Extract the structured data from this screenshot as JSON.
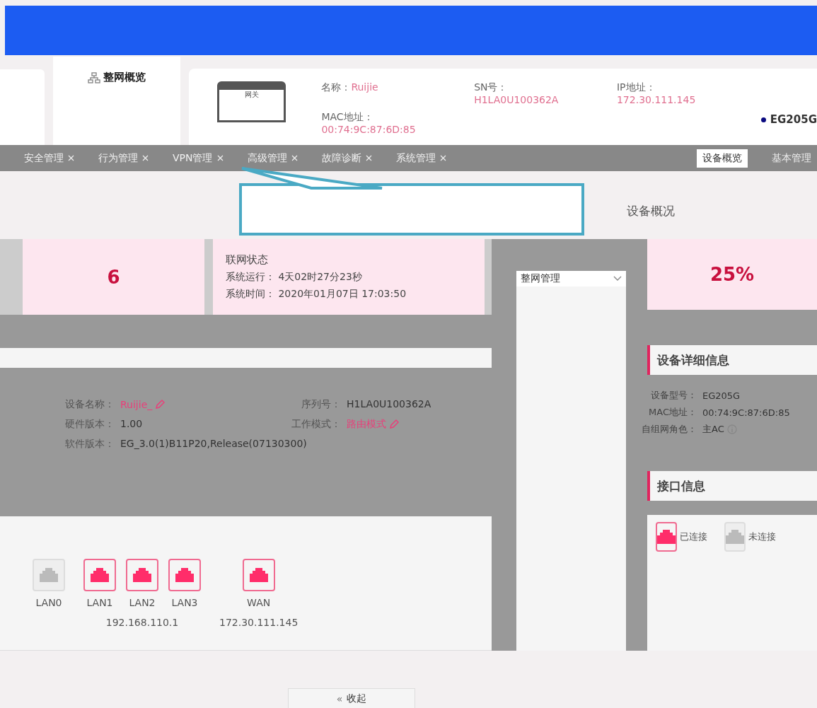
{
  "header_tab": {
    "label": "整网概览",
    "selected": true
  },
  "device": {
    "image_label": "网关",
    "fields": [
      {
        "label": "名称：",
        "value": "Ruijie"
      },
      {
        "label": "SN号：",
        "value": "H1LA0U100362A"
      },
      {
        "label": "IP地址：",
        "value": "172.30.111.145"
      },
      {
        "label": "MAC地址：",
        "value": "00:74:9C:87:6D:85"
      }
    ],
    "model": "EG205G"
  },
  "nav_tabs": [
    {
      "label": "安全管理",
      "selected": false
    },
    {
      "label": "行为管理",
      "selected": false
    },
    {
      "label": "VPN管理",
      "selected": false
    },
    {
      "label": "高级管理",
      "selected": false
    },
    {
      "label": "故障诊断",
      "selected": false
    },
    {
      "label": "系统管理",
      "selected": false
    }
  ],
  "right_tabs": [
    {
      "label": "设备概览",
      "selected": true
    },
    {
      "label": "基本管理",
      "selected": false
    }
  ],
  "section_title": "设备概况",
  "stats": [
    {
      "kind": "number",
      "value": "6"
    },
    {
      "kind": "status",
      "title": "联网状态",
      "lines": [
        {
          "label": "系统运行：",
          "value": "4天02时27分23秒"
        },
        {
          "label": "系统时间：",
          "value": "2020年01月07日 17:03:50"
        }
      ]
    }
  ],
  "device_info": [
    {
      "label": "设备名称：",
      "value": "Ruijie_",
      "editable": true
    },
    {
      "label": "序列号：",
      "value": "H1LA0U100362A",
      "editable": false
    },
    {
      "label": "硬件版本：",
      "value": "1.00",
      "editable": false
    },
    {
      "label": "工作模式：",
      "value": "路由模式",
      "editable": true
    },
    {
      "label": "软件版本：",
      "value": "EG_3.0(1)B11P20,Release(07130300)",
      "editable": false
    }
  ],
  "menu": {
    "label": "整网管理",
    "expanded": false
  },
  "usage": "25%",
  "details": {
    "title": "设备详细信息",
    "rows": [
      {
        "label": "设备型号：",
        "value": "EG205G",
        "info": false
      },
      {
        "label": "MAC地址：",
        "value": "00:74:9C:87:6D:85",
        "info": false
      },
      {
        "label": "自组网角色：",
        "value": "主AC",
        "info": true
      }
    ]
  },
  "interfaces": {
    "title": "接口信息",
    "legend": [
      {
        "label": "已连接",
        "connected": true
      },
      {
        "label": "未连接",
        "connected": false
      }
    ],
    "port_groups": [
      {
        "ports": [
          {
            "name": "LAN0",
            "connected": false
          }
        ]
      },
      {
        "ports": [
          {
            "name": "LAN1",
            "connected": true
          },
          {
            "name": "LAN2",
            "connected": true
          },
          {
            "name": "LAN3",
            "connected": true
          }
        ],
        "address": "192.168.110.1"
      },
      {
        "ports": [
          {
            "name": "WAN",
            "connected": true
          }
        ],
        "address": "172.30.111.145"
      }
    ]
  },
  "collapse_button": {
    "icon": "«",
    "label": "收起"
  }
}
